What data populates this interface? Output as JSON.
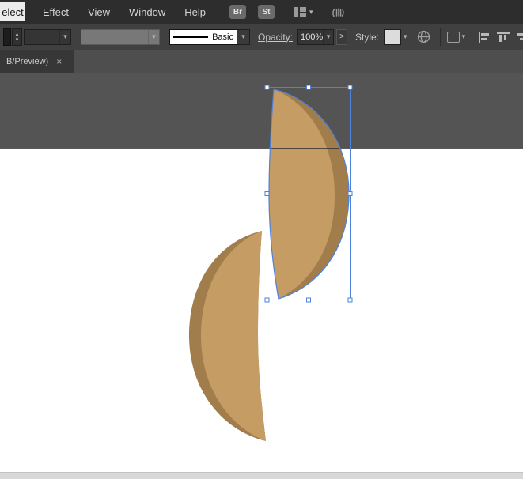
{
  "menu_bar": {
    "partial_item": "elect",
    "items": [
      "Effect",
      "View",
      "Window",
      "Help"
    ],
    "bridge_badge": "Br",
    "stock_badge": "St"
  },
  "control_bar": {
    "stroke_style_label": "Basic",
    "opacity_label": "Opacity:",
    "opacity_value": "100%",
    "more_button": ">",
    "style_label": "Style:"
  },
  "tab_bar": {
    "active_tab_label": "B/Preview)",
    "close_glyph": "×"
  },
  "icons": {
    "caret_down": "▾",
    "stepper_up": "▴",
    "stepper_down": "▾"
  },
  "canvas": {
    "pasteboard_color": "#545454",
    "artboard_color": "#ffffff",
    "selection_color": "#4d82dd",
    "shape_fill": "#c59c63",
    "shape_shadow": "#a27d4c"
  }
}
